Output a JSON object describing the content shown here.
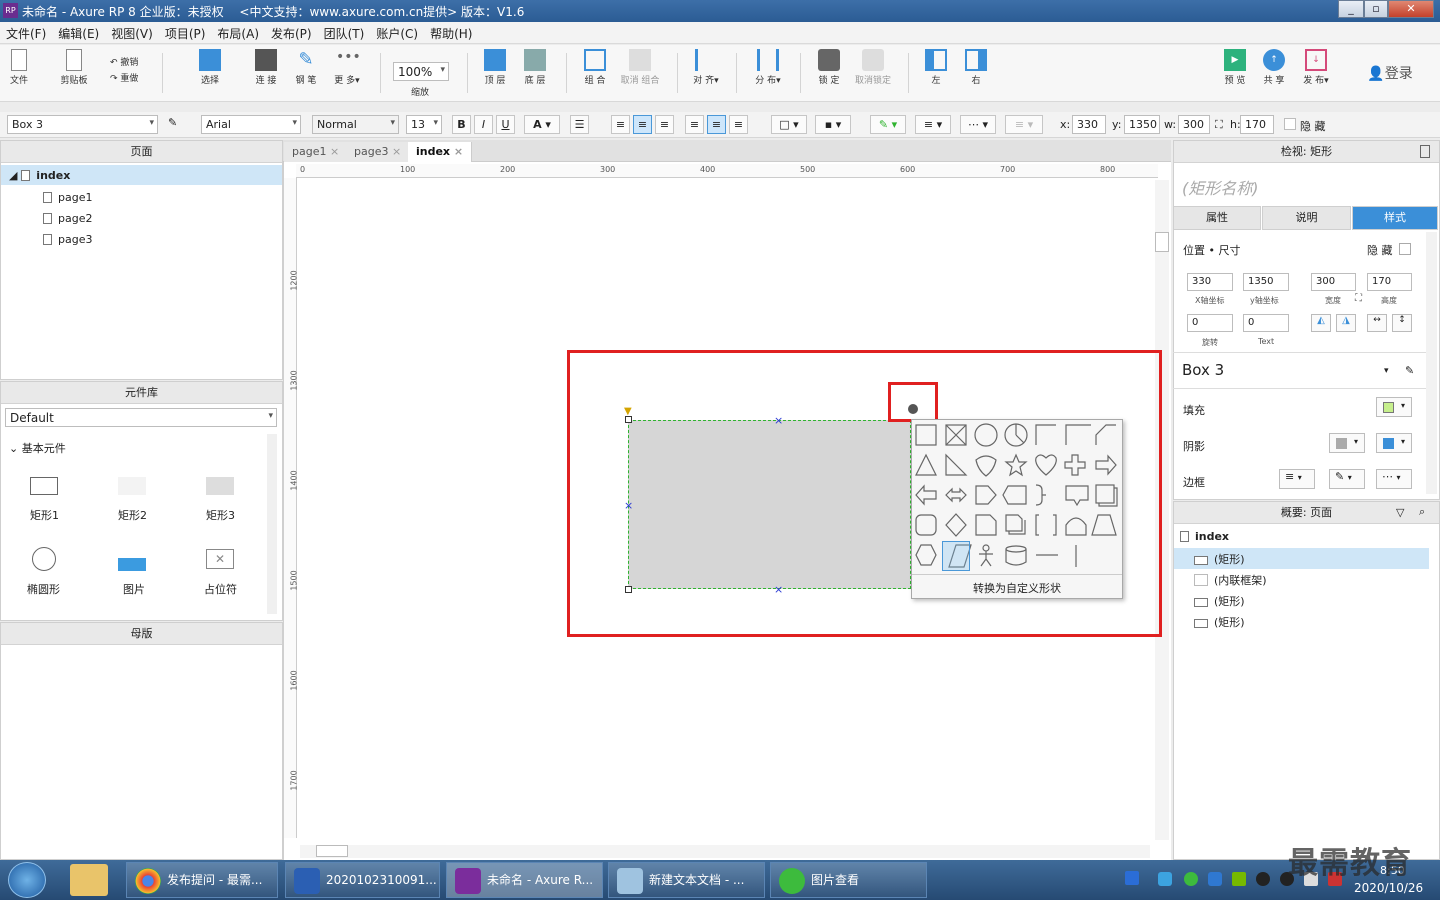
{
  "title_bar": {
    "title": "未命名 - Axure RP 8 企业版：未授权　 <中文支持：www.axure.com.cn提供> 版本：V1.6",
    "app_icon": "RP"
  },
  "menu": [
    "文件(F)",
    "编辑(E)",
    "视图(V)",
    "项目(P)",
    "布局(A)",
    "发布(P)",
    "团队(T)",
    "账户(C)",
    "帮助(H)"
  ],
  "toolbar": {
    "file": "文件",
    "clipboard": "剪贴板",
    "undo": "撤销",
    "redo": "重做",
    "select": "选择",
    "connect": "连 接",
    "pen": "钢 笔",
    "more": "更 多▾",
    "zoom_value": "100%",
    "zoom_label": "缩放",
    "top": "顶 层",
    "bottom": "底 层",
    "group": "组 合",
    "ungroup": "取消 组合",
    "align": "对 齐▾",
    "distribute": "分 布▾",
    "lock": "锁 定",
    "unlock": "取消锁定",
    "left": "左",
    "right": "右",
    "preview": "预 览",
    "share": "共 享",
    "publish": "发 布▾",
    "login": "登录"
  },
  "format_bar": {
    "widget_name": "Box 3",
    "font": "Arial",
    "style": "Normal",
    "size": "13",
    "x_label": "x:",
    "x": "330",
    "y_label": "y:",
    "y": "1350",
    "w_label": "w:",
    "w": "300",
    "h_label": "h:",
    "h": "170",
    "hidden_label": "隐 藏"
  },
  "pages_panel": {
    "title": "页面",
    "root": "index",
    "pages": [
      "page1",
      "page2",
      "page3"
    ]
  },
  "library_panel": {
    "title": "元件库",
    "selected_library": "Default",
    "group": "基本元件",
    "widgets": [
      "矩形1",
      "矩形2",
      "矩形3",
      "椭圆形",
      "图片",
      "占位符"
    ]
  },
  "masters_panel": {
    "title": "母版"
  },
  "tabs": [
    "page1",
    "page3",
    "index"
  ],
  "ruler": {
    "h_ticks": [
      "0",
      "100",
      "200",
      "300",
      "400",
      "500",
      "600",
      "700",
      "800"
    ],
    "v_ticks": [
      "1200",
      "1300",
      "1400",
      "1500",
      "1600",
      "1700"
    ]
  },
  "shape_picker": {
    "convert_label": "转换为自定义形状"
  },
  "inspector": {
    "title": "检视: 矩形",
    "name_placeholder": "(矩形名称)",
    "tabs": [
      "属性",
      "说明",
      "样式"
    ],
    "position_size": "位置 • 尺寸",
    "hidden_label": "隐 藏",
    "x": "330",
    "y": "1350",
    "w": "300",
    "h": "170",
    "x_cap": "X轴坐标",
    "y_cap": "y轴坐标",
    "w_cap": "宽度",
    "h_cap": "高度",
    "rotation": "0",
    "text_rotation": "0",
    "rotation_cap": "旋转",
    "text_cap": "Text",
    "style_name": "Box 3",
    "fill": "填充",
    "shadow": "阴影",
    "border": "边框",
    "fill_color": "#c6ef8c",
    "shadow_color": "#3b8fd8"
  },
  "outline_panel": {
    "title": "概要: 页面",
    "root": "index",
    "items": [
      "(矩形)",
      "(内联框架)",
      "(矩形)",
      "(矩形)"
    ]
  },
  "taskbar": {
    "tasks": [
      "发布提问 - 最需...",
      "2020102310091...",
      "未命名 - Axure R...",
      "新建文本文档 - ...",
      "图片查看"
    ],
    "date": "2020/10/26",
    "time": "8:50",
    "watermark": "最需教育"
  },
  "colors": {
    "accent": "#3b8fd8",
    "highlight_red": "#e02020",
    "selection_green": "#2fb32f",
    "shape_fill": "#d6d6d6"
  }
}
